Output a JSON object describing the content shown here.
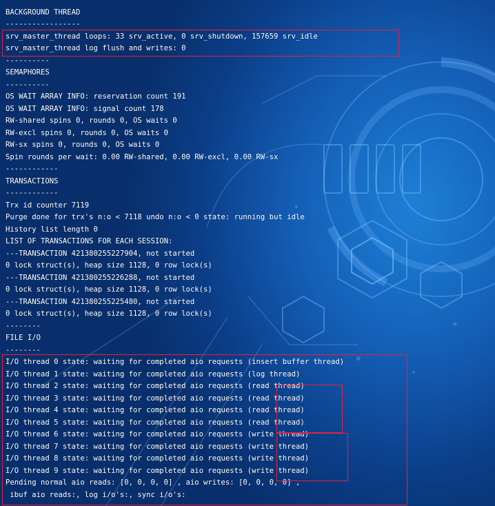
{
  "colors": {
    "text": "#ffffff",
    "highlight_border": "#e8213a",
    "background": "#0b3d86"
  },
  "lines": [
    "-----------------",
    "BACKGROUND THREAD",
    "-----------------",
    "srv_master_thread loops: 33 srv_active, 0 srv_shutdown, 157659 srv_idle",
    "srv_master_thread log flush and writes: 0",
    "----------",
    "SEMAPHORES",
    "----------",
    "OS WAIT ARRAY INFO: reservation count 191",
    "OS WAIT ARRAY INFO: signal count 178",
    "RW-shared spins 0, rounds 0, OS waits 0",
    "RW-excl spins 0, rounds 0, OS waits 0",
    "RW-sx spins 0, rounds 0, OS waits 0",
    "Spin rounds per wait: 0.00 RW-shared, 0.00 RW-excl, 0.00 RW-sx",
    "------------",
    "TRANSACTIONS",
    "------------",
    "Trx id counter 7119",
    "Purge done for trx's n:o < 7118 undo n:o < 0 state: running but idle",
    "History list length 0",
    "LIST OF TRANSACTIONS FOR EACH SESSION:",
    "---TRANSACTION 421380255227904, not started",
    "0 lock struct(s), heap size 1128, 0 row lock(s)",
    "---TRANSACTION 421380255226288, not started",
    "0 lock struct(s), heap size 1128, 0 row lock(s)",
    "---TRANSACTION 421380255225480, not started",
    "0 lock struct(s), heap size 1128, 0 row lock(s)",
    "--------",
    "FILE I/O",
    "--------",
    "I/O thread 0 state: waiting for completed aio requests (insert buffer thread)",
    "I/O thread 1 state: waiting for completed aio requests (log thread)",
    "I/O thread 2 state: waiting for completed aio requests (read thread)",
    "I/O thread 3 state: waiting for completed aio requests (read thread)",
    "I/O thread 4 state: waiting for completed aio requests (read thread)",
    "I/O thread 5 state: waiting for completed aio requests (read thread)",
    "I/O thread 6 state: waiting for completed aio requests (write thread)",
    "I/O thread 7 state: waiting for completed aio requests (write thread)",
    "I/O thread 8 state: waiting for completed aio requests (write thread)",
    "I/O thread 9 state: waiting for completed aio requests (write thread)",
    "Pending normal aio reads: [0, 0, 0, 0] , aio writes: [0, 0, 0, 0] ,",
    " ibuf aio reads:, log i/o's:, sync i/o's:"
  ]
}
